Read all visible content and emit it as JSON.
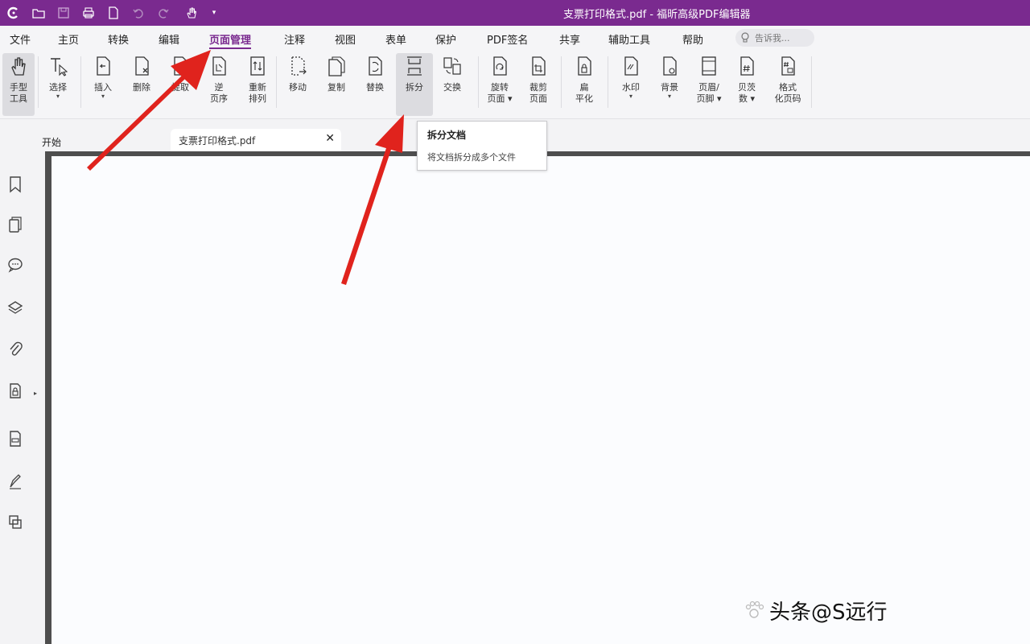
{
  "titlebar": {
    "title": "支票打印格式.pdf - 福昕高级PDF编辑器",
    "bg_color": "#7a2a8f",
    "quick_access": [
      "app-logo-icon",
      "open-folder-icon",
      "save-icon",
      "print-icon",
      "new-doc-icon",
      "undo-icon",
      "redo-icon",
      "hand-tool-icon"
    ]
  },
  "menu": {
    "items": [
      "文件",
      "主页",
      "转换",
      "编辑",
      "页面管理",
      "注释",
      "视图",
      "表单",
      "保护",
      "PDF签名",
      "共享",
      "辅助工具",
      "帮助"
    ],
    "active": "页面管理",
    "search_placeholder": "告诉我..."
  },
  "ribbon": {
    "buttons": [
      {
        "label": "手型",
        "label2": "工具",
        "icon": "hand-icon"
      },
      {
        "label": "选择",
        "label2": "▾",
        "icon": "select-text-icon"
      },
      {
        "label": "插入",
        "label2": "▾",
        "icon": "insert-page-icon"
      },
      {
        "label": "删除",
        "label2": "",
        "icon": "delete-page-icon"
      },
      {
        "label": "提取",
        "label2": "",
        "icon": "extract-page-icon"
      },
      {
        "label": "逆",
        "label2": "页序",
        "icon": "reverse-order-icon"
      },
      {
        "label": "重新",
        "label2": "排列",
        "icon": "rearrange-icon"
      },
      {
        "label": "移动",
        "label2": "",
        "icon": "move-page-icon"
      },
      {
        "label": "复制",
        "label2": "",
        "icon": "copy-page-icon"
      },
      {
        "label": "替换",
        "label2": "",
        "icon": "replace-page-icon"
      },
      {
        "label": "拆分",
        "label2": "",
        "icon": "split-icon"
      },
      {
        "label": "交换",
        "label2": "",
        "icon": "swap-icon"
      },
      {
        "label": "旋转",
        "label2": "页面 ▾",
        "icon": "rotate-page-icon"
      },
      {
        "label": "裁剪",
        "label2": "页面",
        "icon": "crop-page-icon"
      },
      {
        "label": "扁",
        "label2": "平化",
        "icon": "flatten-icon"
      },
      {
        "label": "水印",
        "label2": "▾",
        "icon": "watermark-icon"
      },
      {
        "label": "背景",
        "label2": "▾",
        "icon": "background-icon"
      },
      {
        "label": "页眉/",
        "label2": "页脚 ▾",
        "icon": "header-footer-icon"
      },
      {
        "label": "贝茨",
        "label2": "数 ▾",
        "icon": "bates-number-icon"
      },
      {
        "label": "格式",
        "label2": "化页码",
        "icon": "format-page-number-icon"
      }
    ]
  },
  "tabs": {
    "start_label": "开始",
    "file_label": "支票打印格式.pdf",
    "close_glyph": "✕"
  },
  "tooltip": {
    "title": "拆分文档",
    "description": "将文档拆分成多个文件"
  },
  "sidebar": {
    "icons": [
      "bookmark-icon",
      "pages-icon",
      "comments-icon",
      "layers-icon",
      "attachment-icon",
      "security-icon",
      "form-icon",
      "signature-icon",
      "compare-icon"
    ],
    "collapse_glyph": "▸"
  },
  "watermark": {
    "text": "头条@S远行"
  },
  "colors": {
    "accent": "#7a2a8f",
    "arrow": "#e0231d",
    "page_bg": "#fbfcfe"
  }
}
